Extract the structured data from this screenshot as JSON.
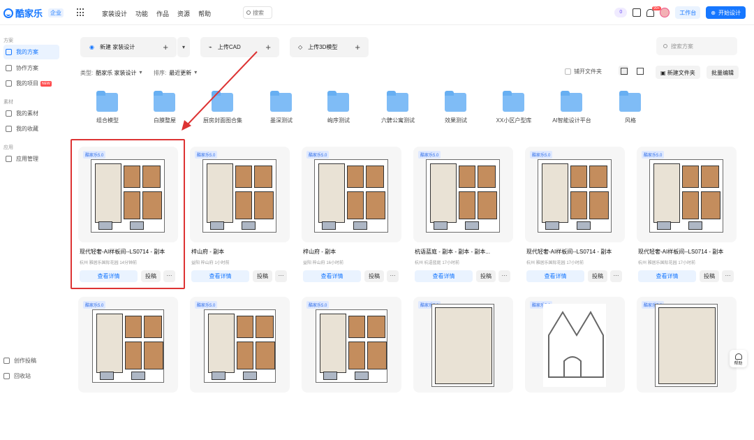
{
  "brand": {
    "name": "酷家乐",
    "tag": "企业"
  },
  "nav": [
    "家装设计",
    "功能",
    "作品",
    "资源",
    "帮助"
  ],
  "top_search": "搜索",
  "top_right": {
    "coins": "0",
    "notice_badge": "99+",
    "workbench": "工作台",
    "start": "开始设计"
  },
  "sidebar": {
    "sections": [
      "方案",
      "素材",
      "应用"
    ],
    "items": [
      "我的方案",
      "协作方案",
      "我的项目",
      "我的素材",
      "我的收藏",
      "应用管理"
    ],
    "new_tag": "NEW",
    "bottom": [
      "创作投稿",
      "回收站"
    ]
  },
  "actions": {
    "new_design": "新建 家装设计",
    "upload_cad": "上传CAD",
    "upload_3d": "上传3D模型",
    "search_placeholder": "搜索方案"
  },
  "filters": {
    "type_label": "类型:",
    "type_value": "酷家乐 家装设计",
    "sort_label": "排序:",
    "sort_value": "最近更新",
    "flat_label": "铺开文件夹",
    "new_folder": "新建文件夹",
    "batch_edit": "批量编辑"
  },
  "folders": [
    "组合模型",
    "白膜整屋",
    "厨房封面图合集",
    "墨深测试",
    "峋序测试",
    "六髀公寓测试",
    "效果测试",
    "XX小区户型库",
    "AI智能设计平台",
    "风格"
  ],
  "cards": [
    {
      "badge": "酷家乐5.0",
      "title": "现代轻奢-AI样板间--LS0714 - 副本",
      "meta": "杭州 雅居乐国际花园   14分钟前",
      "detail": "查看详情",
      "submit": "投稿",
      "more": "···"
    },
    {
      "badge": "酷家乐5.0",
      "title": "梓山府 - 副本",
      "meta": "益阳 梓山府   1小时前",
      "detail": "查看详情",
      "submit": "投稿",
      "more": "···"
    },
    {
      "badge": "酷家乐5.0",
      "title": "梓山府 - 副本",
      "meta": "益阳 梓山府   16小时前",
      "detail": "查看详情",
      "submit": "投稿",
      "more": "···"
    },
    {
      "badge": "酷家乐5.0",
      "title": "杭语蓝庭 - 副本 - 副本 - 副本...",
      "meta": "杭州 杭语蓝庭   17小时前",
      "detail": "查看详情",
      "submit": "投稿",
      "more": "···"
    },
    {
      "badge": "酷家乐5.0",
      "title": "现代轻奢-AI样板间--LS0714 - 副本",
      "meta": "杭州 雅居乐国际花园   17小时前",
      "detail": "查看详情",
      "submit": "投稿",
      "more": "···"
    },
    {
      "badge": "酷家乐5.0",
      "title": "现代轻奢-AI样板间--LS0714 - 副本",
      "meta": "杭州 雅居乐国际花园   17小时前",
      "detail": "查看详情",
      "submit": "投稿",
      "more": "···"
    },
    {
      "badge": "酷家乐5.0"
    },
    {
      "badge": "酷家乐5.0"
    },
    {
      "badge": "酷家乐5.0"
    },
    {
      "badge": "酷家乐5.0"
    },
    {
      "badge": "酷家乐5.0"
    },
    {
      "badge": "酷家乐5.0"
    }
  ],
  "help": "帮助"
}
